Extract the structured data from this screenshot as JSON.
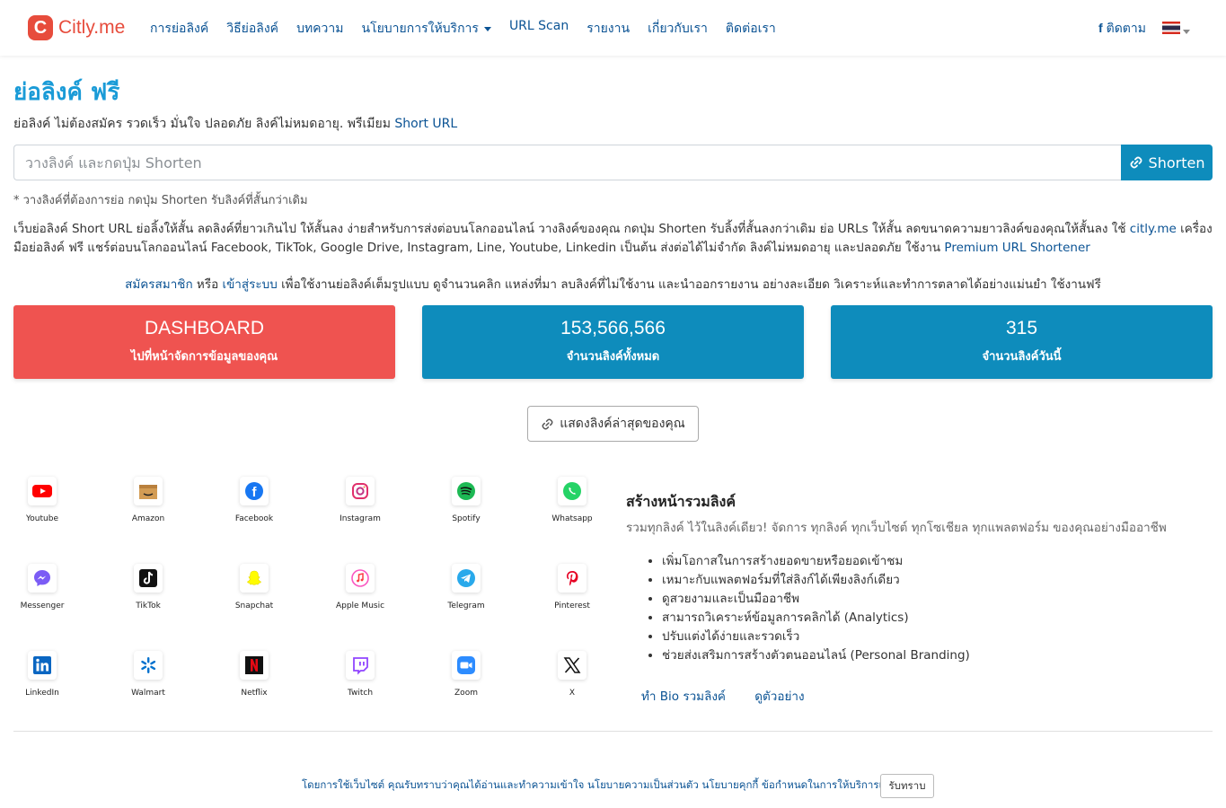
{
  "brand": {
    "logo_letter": "C",
    "name": "Citly.me"
  },
  "nav": {
    "items": [
      "การย่อลิงค์",
      "วิธีย่อลิงค์",
      "บทความ",
      "นโยบายการให้บริการ",
      "URL Scan",
      "รายงาน",
      "เกี่ยวกับเรา",
      "ติดต่อเรา"
    ],
    "follow_icon": "f",
    "follow_label": "ติดตาม",
    "language_flag": "thailand-flag"
  },
  "header": {
    "title": "ย่อลิงค์ ฟรี",
    "subtitle_prefix": "ย่อลิงค์ ไม่ต้องสมัคร รวดเร็ว มั่นใจ ปลอดภัย ลิงค์ไม่หมดอายุ. พรีเมียม ",
    "subtitle_link": "Short URL"
  },
  "shortener": {
    "placeholder": "วางลิงค์ และกดปุ่ม Shorten",
    "button_label": "Shorten",
    "hint": "* วางลิงค์ที่ต้องการย่อ กดปุ่ม Shorten รับลิงค์ที่สั้นกว่าเดิม"
  },
  "description": {
    "text_1": "เว็บย่อลิงค์ Short URL ย่อลิ้งให้สั้น ลดลิงค์ที่ยาวเกินไป ให้สั้นลง ง่ายสำหรับการส่งต่อบนโลกออนไลน์ วางลิงค์ของคุณ กดปุ่ม Shorten รับลิ้งที่สั้นลงกว่าเดิม ย่อ URLs ให้สั้น ลดขนาดความยาวลิงค์ของคุณให้สั้นลง ใช้ ",
    "link_1": "citly.me",
    "text_2": " เครื่องมือย่อลิงค์ ฟรี แชร์ต่อบนโลกออนไลน์ Facebook, TikTok, Google Drive, Instagram, Line, Youtube, Linkedin เป็นต้น ส่งต่อได้ไม่จำกัด ลิงค์ไม่หมดอายุ และปลอดภัย ใช้งาน ",
    "link_2": "Premium URL Shortener"
  },
  "register": {
    "signup": "สมัครสมาชิก",
    "or": " หรือ ",
    "login": "เข้าสู่ระบบ",
    "rest": " เพื่อใช้งานย่อลิงค์เต็มรูปแบบ ดูจำนวนคลิก แหล่งที่มา ลบลิงค์ที่ไม่ใช้งาน และนำออกรายงาน อย่างละเอียด วิเคราะห์และทำการตลาดได้อย่างแม่นยำ ใช้งานฟรี"
  },
  "stats": {
    "dashboard": {
      "title": "DASHBOARD",
      "subtitle": "ไปที่หน้าจัดการข้อมูลของคุณ"
    },
    "total": {
      "value": "153,566,566",
      "label": "จำนวนลิงค์ทั้งหมด"
    },
    "today": {
      "value": "315",
      "label": "จำนวนลิงค์วันนี้"
    }
  },
  "latest_button": "แสดงลิงค์ล่าสุดของคุณ",
  "platforms": [
    {
      "label": "Youtube",
      "icon": "youtube-icon"
    },
    {
      "label": "Amazon",
      "icon": "amazon-icon"
    },
    {
      "label": "Facebook",
      "icon": "facebook-icon"
    },
    {
      "label": "Instagram",
      "icon": "instagram-icon"
    },
    {
      "label": "Spotify",
      "icon": "spotify-icon"
    },
    {
      "label": "Whatsapp",
      "icon": "whatsapp-icon"
    },
    {
      "label": "Messenger",
      "icon": "messenger-icon"
    },
    {
      "label": "TikTok",
      "icon": "tiktok-icon"
    },
    {
      "label": "Snapchat",
      "icon": "snapchat-icon"
    },
    {
      "label": "Apple Music",
      "icon": "apple-music-icon"
    },
    {
      "label": "Telegram",
      "icon": "telegram-icon"
    },
    {
      "label": "Pinterest",
      "icon": "pinterest-icon"
    },
    {
      "label": "LinkedIn",
      "icon": "linkedin-icon"
    },
    {
      "label": "Walmart",
      "icon": "walmart-icon"
    },
    {
      "label": "Netflix",
      "icon": "netflix-icon"
    },
    {
      "label": "Twitch",
      "icon": "twitch-icon"
    },
    {
      "label": "Zoom",
      "icon": "zoom-icon"
    },
    {
      "label": "X",
      "icon": "x-icon"
    }
  ],
  "bio": {
    "title": "สร้างหน้ารวมลิงค์",
    "description": "รวมทุกลิงค์ ไว้ในลิงค์เดียว! จัดการ ทุกลิงค์ ทุกเว็บไซต์ ทุกโซเชียล ทุกแพลตฟอร์ม ของคุณอย่างมืออาชีพ",
    "features": [
      "เพิ่มโอกาสในการสร้างยอดขายหรือยอดเข้าชม",
      "เหมาะกับแพลตฟอร์มที่ใส่ลิงก์ได้เพียงลิงก์เดียว",
      "ดูสวยงามและเป็นมืออาชีพ",
      "สามารถวิเคราะห์ข้อมูลการคลิกได้ (Analytics)",
      "ปรับแต่งได้ง่ายและรวดเร็ว",
      "ช่วยส่งเสริมการสร้างตัวตนออนไลน์ (Personal Branding)"
    ],
    "make_link": "ทำ Bio รวมลิงค์",
    "example_link": "ดูตัวอย่าง"
  },
  "cookie": {
    "text": "โดยการใช้เว็บไซต์ คุณรับทราบว่าคุณได้อ่านและทำความเข้าใจ นโยบายความเป็นส่วนตัว นโยบายคุกกี้ ข้อกำหนดในการให้บริการแล้ว",
    "button": "รับทราบ"
  }
}
